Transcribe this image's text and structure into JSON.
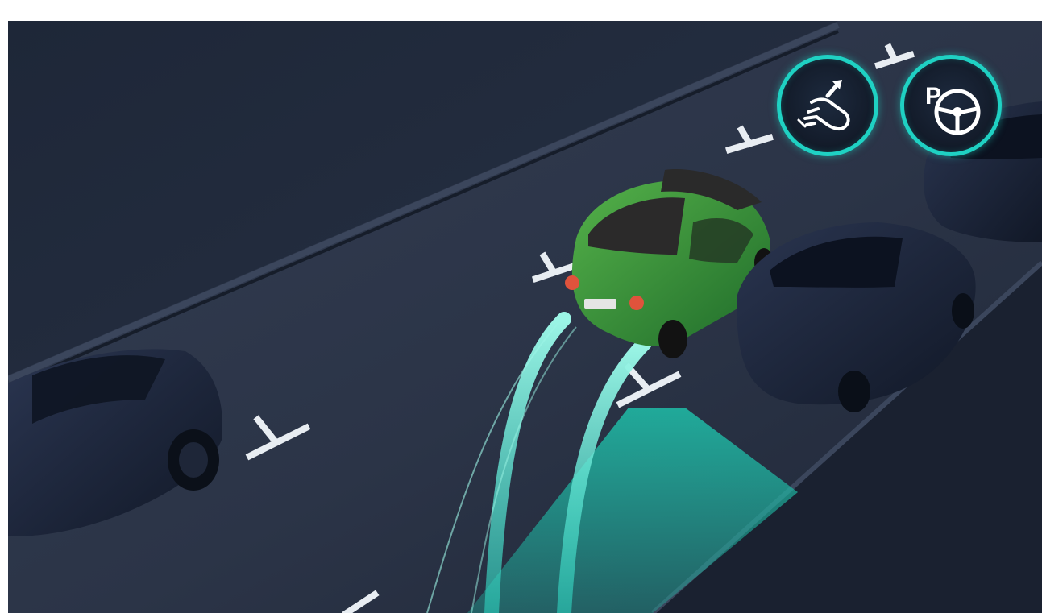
{
  "image": {
    "kind": "advanced park assist illustration",
    "colors": {
      "background": "#ffffff",
      "road": "#2b3447",
      "road_dark": "#1c2433",
      "sidewalk": "#232c3d",
      "highlight": "#1fd1c3",
      "highlight_soft": "#2ec4ad",
      "car_green": "#2e8f3a",
      "parked_car": "#1a2236",
      "markings": "#e8edf2"
    }
  },
  "feature_icons": [
    {
      "name": "hands-free-icon",
      "ring_color": "#1fd1c3"
    },
    {
      "name": "park-assist-steering-icon",
      "ring_color": "#1fd1c3",
      "glyph": "P"
    }
  ]
}
